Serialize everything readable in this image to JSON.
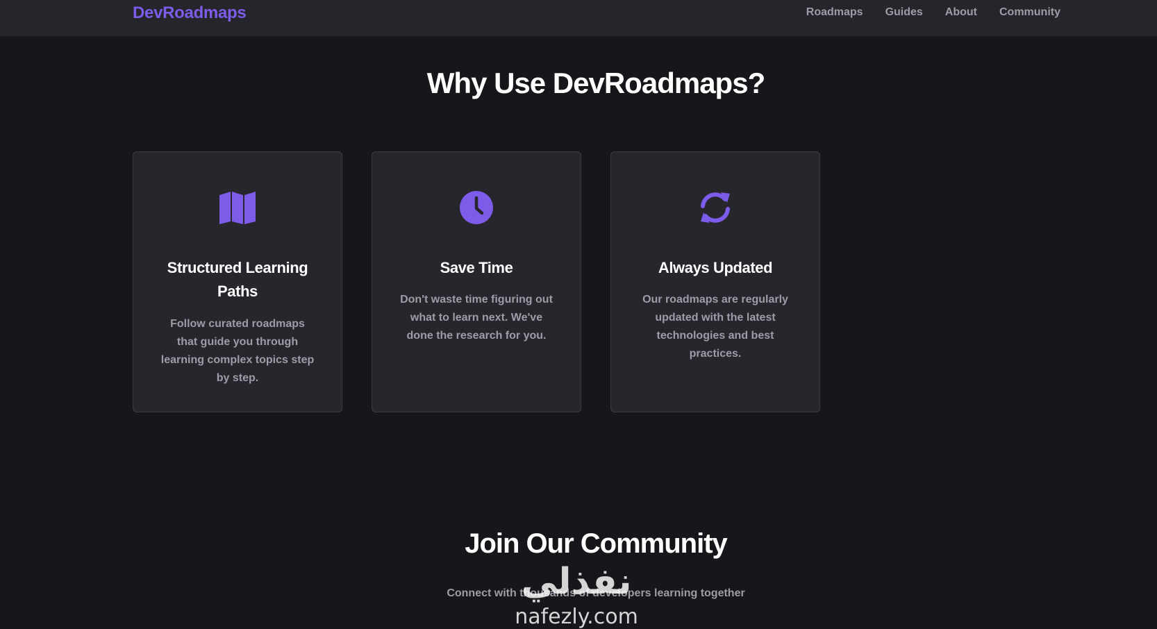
{
  "header": {
    "logo": "DevRoadmaps",
    "nav": [
      "Roadmaps",
      "Guides",
      "About",
      "Community"
    ]
  },
  "why": {
    "title": "Why Use DevRoadmaps?",
    "cards": [
      {
        "icon": "map-icon",
        "title": "Structured Learning Paths",
        "description": "Follow curated roadmaps that guide you through learning complex topics step by step."
      },
      {
        "icon": "clock-icon",
        "title": "Save Time",
        "description": "Don't waste time figuring out what to learn next. We've done the research for you."
      },
      {
        "icon": "refresh-icon",
        "title": "Always Updated",
        "description": "Our roadmaps are regularly updated with the latest technologies and best practices."
      }
    ]
  },
  "community": {
    "title": "Join Our Community",
    "subtitle": "Connect with thousands of developers learning together"
  },
  "watermark": {
    "arabic": "نفذلي",
    "latin": "nafezly.com"
  },
  "colors": {
    "background": "#17171b",
    "navbar": "#25252b",
    "card": "#26262c",
    "accent": "#7c5ce8",
    "muted_text": "#9d9da8"
  }
}
